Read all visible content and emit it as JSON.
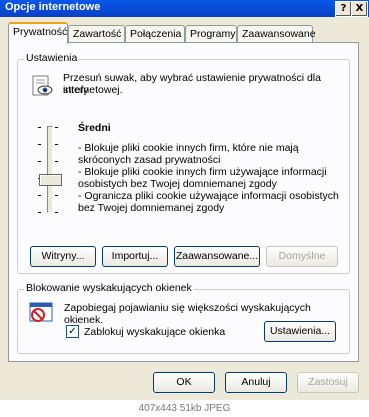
{
  "window": {
    "title": "Opcje internetowe",
    "help_label": "?",
    "close_label": "X"
  },
  "tabs": [
    {
      "label": "Prywatność",
      "active": true
    },
    {
      "label": "Zawartość",
      "active": false
    },
    {
      "label": "Połączenia",
      "active": false
    },
    {
      "label": "Programy",
      "active": false
    },
    {
      "label": "Zaawansowane",
      "active": false
    }
  ],
  "settings": {
    "group_label": "Ustawienia",
    "intro_line1": "Przesuń suwak, aby wybrać ustawienie prywatności dla strefy",
    "intro_line2": "internetowej.",
    "level_name": "Średni",
    "desc_lines": [
      "- Blokuje pliki cookie innych firm, które nie mają",
      "skróconych zasad prywatności",
      "- Blokuje pliki cookie innych firm używające informacji",
      "osobistych bez Twojej domniemanej zgody",
      "- Ogranicza pliki cookie używające informacji osobistych",
      "bez Twojej domniemanej zgody"
    ],
    "buttons": {
      "sites": "Witryny...",
      "import": "Importuj...",
      "advanced": "Zaawansowane...",
      "default": "Domyślne"
    }
  },
  "popup": {
    "group_label": "Blokowanie wyskakujących okienek",
    "description": "Zapobiegaj pojawianiu się większości wyskakujących okienek.",
    "checkbox_label": "Zablokuj wyskakujące okienka",
    "checkbox_mark": "✓",
    "settings_button": "Ustawienia..."
  },
  "footer": {
    "ok": "OK",
    "cancel": "Anuluj",
    "apply": "Zastosuj"
  },
  "image_caption": "407x443 51kb JPEG",
  "colors": {
    "titlebar": "#0a58e8",
    "dialog_bg": "#ece9d8",
    "panel_bg": "#fcfcfe",
    "active_tab_accent": "#e8a317"
  }
}
